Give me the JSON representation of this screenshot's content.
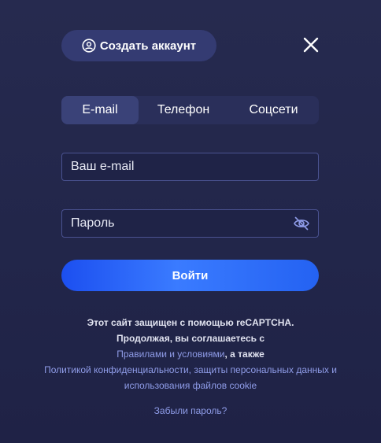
{
  "header": {
    "create_account_label": "Создать аккаунт",
    "create_account_icon": "user-circle-icon",
    "close_icon": "close-icon"
  },
  "tabs": [
    {
      "label": "E-mail",
      "active": true
    },
    {
      "label": "Телефон",
      "active": false
    },
    {
      "label": "Соцсети",
      "active": false
    }
  ],
  "form": {
    "email_placeholder": "Ваш e-mail",
    "password_placeholder": "Пароль",
    "password_toggle_icon": "eye-off-icon",
    "login_label": "Войти"
  },
  "legal": {
    "line1": "Этот сайт защищен с помощью reCAPTCHA.",
    "line2": "Продолжая, вы соглашаетесь с",
    "terms_link": "Правилами и условиями",
    "line3_suffix": ", а также",
    "privacy_link": "Политикой конфиденциальности, защиты персональных данных и использования файлов cookie"
  },
  "forgot_password": "Забыли пароль?",
  "colors": {
    "background": "#22264a",
    "accent": "#2462f2",
    "link": "#8f9ce8"
  }
}
